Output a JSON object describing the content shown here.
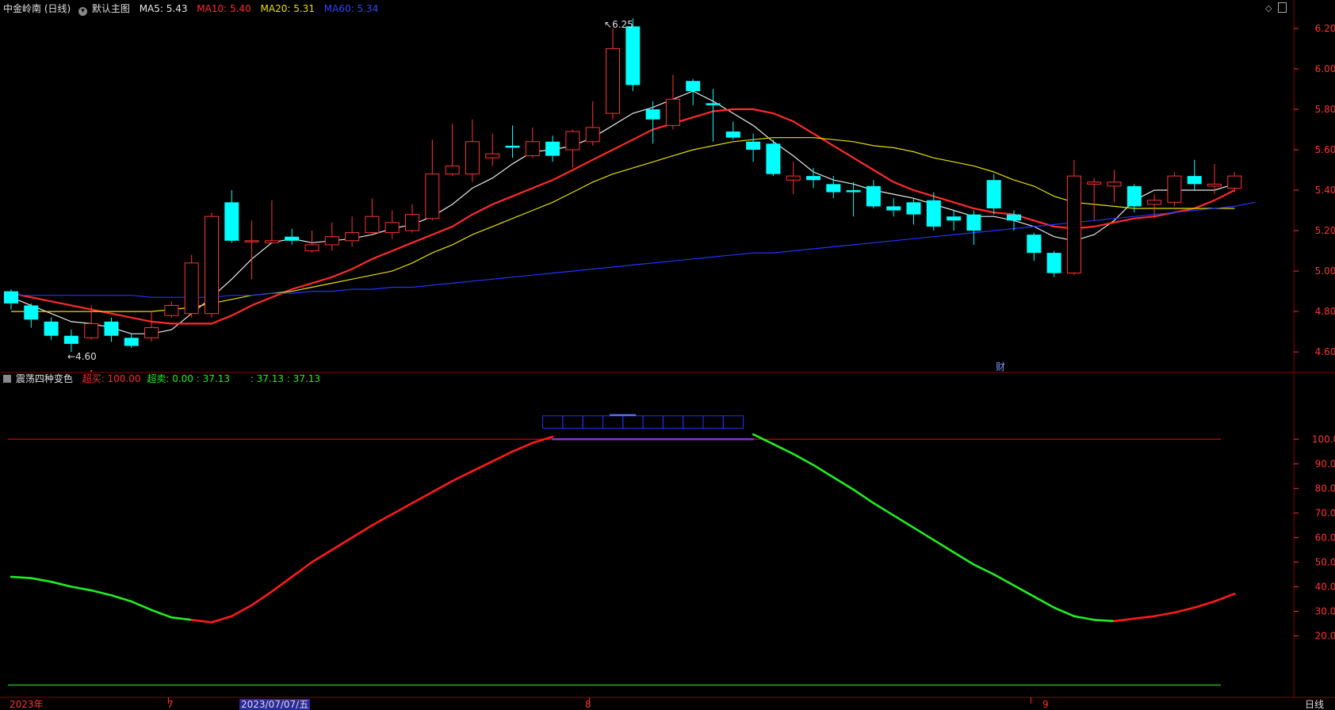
{
  "header": {
    "title": "中金岭南 (日线)",
    "chart_menu": "默认主图",
    "ma5": {
      "label": "MA5: 5.43",
      "color": "#e8e8e8"
    },
    "ma10": {
      "label": "MA10: 5.40",
      "color": "#ff2a2a"
    },
    "ma20": {
      "label": "MA20: 5.31",
      "color": "#e8e000"
    },
    "ma60": {
      "label": "MA60: 5.34",
      "color": "#2233ff"
    }
  },
  "indicator_header": {
    "name": "震荡四种变色",
    "overbought_label": "超买: 100.00",
    "oversold_label": "超卖: 0.00 : 37.13",
    "value_label": ": 37.13 : 37.13"
  },
  "annotations": {
    "high": "6.25",
    "low": "4.60",
    "marker": "财",
    "period_button": "日线"
  },
  "x_axis": {
    "labels": [
      {
        "text": "2023年",
        "index": 0
      },
      {
        "text": "7",
        "index": 8
      },
      {
        "text": "2023/07/07/五",
        "index": 12,
        "highlight": true
      },
      {
        "text": "8",
        "index": 29
      },
      {
        "text": "9",
        "index": 51
      }
    ]
  },
  "colors": {
    "up": "#ff3333",
    "down": "#00ffff",
    "bg": "#000000",
    "grid": "#7a0000",
    "axis_text": "#ff3333",
    "osc_up": "#ff1a1a",
    "osc_down": "#22ee22"
  },
  "chart_data": [
    {
      "type": "candlestick",
      "title": "中金岭南 (日线)",
      "ylim": [
        4.53,
        6.27
      ],
      "yticks": [
        4.6,
        4.8,
        5.0,
        5.2,
        5.4,
        5.6,
        5.8,
        6.0,
        6.2
      ],
      "candles": [
        [
          4.9,
          4.84,
          4.91,
          4.81
        ],
        [
          4.83,
          4.76,
          4.84,
          4.72
        ],
        [
          4.75,
          4.68,
          4.77,
          4.66
        ],
        [
          4.68,
          4.64,
          4.71,
          4.6
        ],
        [
          4.67,
          4.74,
          4.83,
          4.66
        ],
        [
          4.75,
          4.68,
          4.77,
          4.65
        ],
        [
          4.67,
          4.63,
          4.69,
          4.62
        ],
        [
          4.67,
          4.72,
          4.8,
          4.65
        ],
        [
          4.78,
          4.83,
          4.85,
          4.77
        ],
        [
          4.79,
          5.04,
          5.08,
          4.77
        ],
        [
          4.79,
          5.27,
          5.29,
          4.77
        ],
        [
          5.34,
          5.15,
          5.4,
          5.14
        ],
        [
          5.15,
          5.15,
          5.25,
          4.96
        ],
        [
          5.14,
          5.15,
          5.35,
          5.14
        ],
        [
          5.17,
          5.15,
          5.21,
          5.13
        ],
        [
          5.1,
          5.13,
          5.2,
          5.09
        ],
        [
          5.13,
          5.17,
          5.24,
          5.1
        ],
        [
          5.15,
          5.19,
          5.27,
          5.12
        ],
        [
          5.19,
          5.27,
          5.36,
          5.18
        ],
        [
          5.19,
          5.24,
          5.3,
          5.16
        ],
        [
          5.2,
          5.28,
          5.33,
          5.19
        ],
        [
          5.26,
          5.48,
          5.65,
          5.25
        ],
        [
          5.48,
          5.52,
          5.73,
          5.47
        ],
        [
          5.48,
          5.64,
          5.75,
          5.44
        ],
        [
          5.56,
          5.58,
          5.68,
          5.52
        ],
        [
          5.62,
          5.61,
          5.72,
          5.56
        ],
        [
          5.57,
          5.64,
          5.71,
          5.56
        ],
        [
          5.64,
          5.57,
          5.67,
          5.54
        ],
        [
          5.6,
          5.69,
          5.7,
          5.51
        ],
        [
          5.64,
          5.71,
          5.84,
          5.62
        ],
        [
          5.78,
          6.1,
          6.2,
          5.75
        ],
        [
          6.21,
          5.92,
          6.25,
          5.89
        ],
        [
          5.8,
          5.75,
          5.84,
          5.63
        ],
        [
          5.72,
          5.85,
          5.97,
          5.7
        ],
        [
          5.94,
          5.89,
          5.95,
          5.82
        ],
        [
          5.83,
          5.82,
          5.9,
          5.64
        ],
        [
          5.69,
          5.66,
          5.74,
          5.65
        ],
        [
          5.64,
          5.6,
          5.68,
          5.54
        ],
        [
          5.63,
          5.48,
          5.65,
          5.47
        ],
        [
          5.45,
          5.47,
          5.54,
          5.38
        ],
        [
          5.47,
          5.45,
          5.51,
          5.41
        ],
        [
          5.43,
          5.39,
          5.47,
          5.36
        ],
        [
          5.4,
          5.39,
          5.44,
          5.27
        ],
        [
          5.42,
          5.32,
          5.45,
          5.31
        ],
        [
          5.32,
          5.3,
          5.36,
          5.27
        ],
        [
          5.34,
          5.28,
          5.36,
          5.23
        ],
        [
          5.35,
          5.22,
          5.39,
          5.2
        ],
        [
          5.27,
          5.25,
          5.3,
          5.2
        ],
        [
          5.28,
          5.2,
          5.3,
          5.13
        ],
        [
          5.45,
          5.31,
          5.48,
          5.28
        ],
        [
          5.28,
          5.25,
          5.3,
          5.2
        ],
        [
          5.18,
          5.09,
          5.19,
          5.05
        ],
        [
          5.09,
          4.99,
          5.1,
          4.97
        ],
        [
          4.99,
          5.47,
          5.55,
          4.98
        ],
        [
          5.43,
          5.44,
          5.46,
          5.25
        ],
        [
          5.42,
          5.44,
          5.5,
          5.34
        ],
        [
          5.42,
          5.32,
          5.43,
          5.29
        ],
        [
          5.33,
          5.35,
          5.38,
          5.26
        ],
        [
          5.34,
          5.47,
          5.49,
          5.32
        ],
        [
          5.47,
          5.43,
          5.55,
          5.4
        ],
        [
          5.42,
          5.43,
          5.53,
          5.38
        ],
        [
          5.41,
          5.47,
          5.49,
          5.39
        ]
      ],
      "series": [
        {
          "name": "MA5",
          "color": "#e8e8e8",
          "values": [
            4.87,
            4.83,
            4.79,
            4.75,
            4.74,
            4.72,
            4.69,
            4.69,
            4.71,
            4.79,
            4.87,
            4.96,
            5.06,
            5.14,
            5.16,
            5.14,
            5.15,
            5.16,
            5.18,
            5.21,
            5.23,
            5.27,
            5.33,
            5.41,
            5.46,
            5.53,
            5.59,
            5.6,
            5.62,
            5.66,
            5.72,
            5.78,
            5.81,
            5.85,
            5.89,
            5.84,
            5.78,
            5.72,
            5.64,
            5.57,
            5.49,
            5.45,
            5.43,
            5.4,
            5.38,
            5.36,
            5.33,
            5.3,
            5.27,
            5.27,
            5.25,
            5.22,
            5.17,
            5.15,
            5.18,
            5.25,
            5.35,
            5.4,
            5.4,
            5.4,
            5.4,
            5.43
          ]
        },
        {
          "name": "MA10",
          "color": "#ff2a2a",
          "values": [
            4.89,
            4.87,
            4.85,
            4.83,
            4.81,
            4.79,
            4.77,
            4.75,
            4.74,
            4.74,
            4.74,
            4.78,
            4.83,
            4.87,
            4.91,
            4.94,
            4.97,
            5.01,
            5.06,
            5.1,
            5.14,
            5.18,
            5.22,
            5.28,
            5.33,
            5.37,
            5.41,
            5.45,
            5.5,
            5.55,
            5.6,
            5.65,
            5.7,
            5.73,
            5.76,
            5.79,
            5.8,
            5.8,
            5.78,
            5.74,
            5.68,
            5.62,
            5.56,
            5.5,
            5.44,
            5.4,
            5.37,
            5.34,
            5.31,
            5.29,
            5.28,
            5.25,
            5.22,
            5.21,
            5.22,
            5.24,
            5.26,
            5.27,
            5.29,
            5.31,
            5.35,
            5.4
          ]
        },
        {
          "name": "MA20",
          "color": "#e8e000",
          "values": [
            4.8,
            4.8,
            4.8,
            4.8,
            4.8,
            4.8,
            4.8,
            4.8,
            4.81,
            4.82,
            4.84,
            4.86,
            4.88,
            4.89,
            4.9,
            4.92,
            4.94,
            4.96,
            4.98,
            5.0,
            5.04,
            5.09,
            5.13,
            5.18,
            5.22,
            5.26,
            5.3,
            5.34,
            5.39,
            5.44,
            5.48,
            5.51,
            5.54,
            5.57,
            5.6,
            5.62,
            5.64,
            5.65,
            5.66,
            5.66,
            5.66,
            5.65,
            5.64,
            5.62,
            5.61,
            5.59,
            5.56,
            5.54,
            5.52,
            5.49,
            5.45,
            5.42,
            5.37,
            5.34,
            5.33,
            5.32,
            5.31,
            5.31,
            5.31,
            5.31,
            5.31,
            5.31
          ]
        },
        {
          "name": "MA60",
          "color": "#2233ff",
          "values": [
            4.88,
            4.88,
            4.88,
            4.88,
            4.88,
            4.88,
            4.88,
            4.87,
            4.87,
            4.87,
            4.87,
            4.88,
            4.88,
            4.89,
            4.89,
            4.9,
            4.9,
            4.91,
            4.91,
            4.92,
            4.92,
            4.93,
            4.94,
            4.95,
            4.96,
            4.97,
            4.98,
            4.99,
            5.0,
            5.01,
            5.02,
            5.03,
            5.04,
            5.05,
            5.06,
            5.07,
            5.08,
            5.09,
            5.09,
            5.1,
            5.11,
            5.12,
            5.13,
            5.14,
            5.15,
            5.16,
            5.17,
            5.18,
            5.19,
            5.2,
            5.21,
            5.22,
            5.23,
            5.24,
            5.25,
            5.26,
            5.27,
            5.28,
            5.29,
            5.3,
            5.31,
            5.32,
            5.34
          ]
        }
      ]
    },
    {
      "type": "line",
      "title": "震荡四种变色",
      "ylim": [
        -5,
        122
      ],
      "yticks": [
        20,
        30,
        40,
        50,
        60,
        70,
        80,
        90,
        100
      ],
      "overbought": 100,
      "oversold": 0,
      "values": [
        44,
        43.5,
        42,
        40,
        38.5,
        36.5,
        34,
        30.5,
        27.5,
        26.5,
        25.5,
        28,
        32.5,
        38,
        44,
        50,
        55,
        60,
        65,
        69.5,
        74,
        78.5,
        83,
        87,
        91,
        95,
        98.5,
        101,
        104,
        107,
        108,
        109,
        109,
        108.5,
        108,
        107,
        105,
        102,
        98,
        94,
        89.5,
        84.5,
        79.5,
        74,
        69,
        64,
        59,
        54,
        49,
        45,
        40.5,
        36,
        31.5,
        28,
        26.5,
        26,
        27,
        28,
        29.5,
        31.5,
        34,
        37.13
      ],
      "segment_colors": [
        "down",
        "down",
        "down",
        "down",
        "down",
        "down",
        "down",
        "down",
        "down",
        "up",
        "up",
        "up",
        "up",
        "up",
        "up",
        "up",
        "up",
        "up",
        "up",
        "up",
        "up",
        "up",
        "up",
        "up",
        "up",
        "up",
        "up",
        "top",
        "top",
        "top",
        "top",
        "top",
        "top",
        "top",
        "top",
        "top",
        "top",
        "down",
        "down",
        "down",
        "down",
        "down",
        "down",
        "down",
        "down",
        "down",
        "down",
        "down",
        "down",
        "down",
        "down",
        "down",
        "down",
        "down",
        "down",
        "up",
        "up",
        "up",
        "up",
        "up",
        "up"
      ]
    }
  ]
}
